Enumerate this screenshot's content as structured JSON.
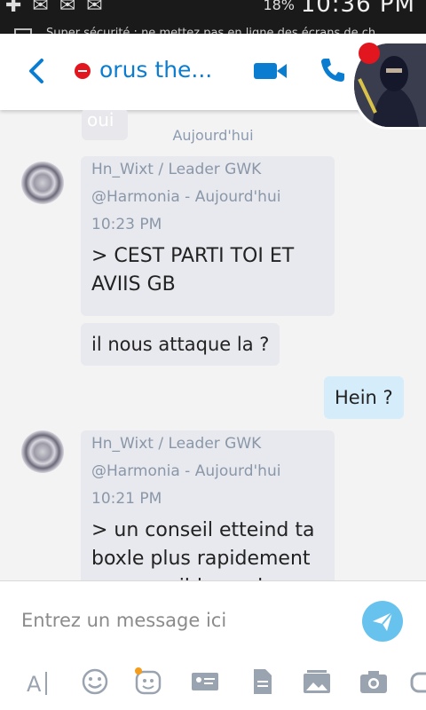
{
  "status_bar": {
    "battery": "18%",
    "clock": "10:36 PM"
  },
  "notification_strip": "Super sécurité : ne mettez pas en ligne des écrans de ch...",
  "header": {
    "title": "orus the...",
    "status": "busy"
  },
  "chat": {
    "ghost_text": "oui",
    "date_separator": "Aujourd'hui",
    "messages": [
      {
        "direction": "in",
        "quote_author": "Hn_Wixt / Leader GWK",
        "quote_meta": "@Harmonia - Aujourd'hui 10:23 PM",
        "quote_text": "> CEST PARTI TOI ET AVIIS GB"
      },
      {
        "direction": "in",
        "text": "il nous attaque la ?"
      },
      {
        "direction": "out",
        "text": "Hein ?"
      },
      {
        "direction": "in",
        "quote_author": "Hn_Wixt / Leader GWK",
        "quote_meta": "@Harmonia - Aujourd'hui 10:21 PM",
        "quote_text": "> un conseil etteind ta boxle plus rapidement que possible car la sa"
      }
    ]
  },
  "compose": {
    "placeholder": "Entrez un message ici"
  },
  "toolbar": [
    "font-icon",
    "emoticon-icon",
    "mojis-icon",
    "contact-card-icon",
    "file-icon",
    "photo-gallery-icon",
    "camera-icon",
    "more-icon"
  ],
  "colors": {
    "accent": "#0a7dd1",
    "busy": "#e2161e",
    "send": "#67c3ee",
    "incoming_bubble": "#e8e9ee",
    "outgoing_bubble": "#d5ecfb"
  }
}
